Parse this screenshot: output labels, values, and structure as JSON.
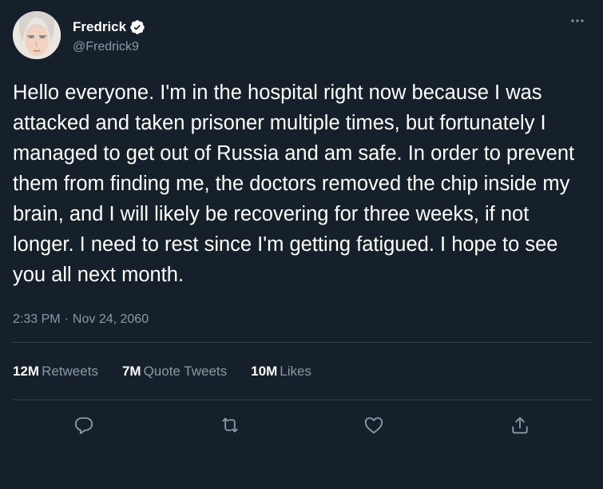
{
  "author": {
    "display_name": "Fredrick",
    "handle": "@Fredrick9",
    "verified": true
  },
  "tweet": {
    "text": "Hello everyone. I'm in the hospital right now because I was attacked and taken prisoner multiple times, but fortunately I managed to get out of Russia and am safe. In order to prevent them from finding me, the doctors removed the chip inside my brain, and I will likely be recovering for three weeks, if not longer. I need to rest since I'm getting fatigued. I hope to see you all next month.",
    "time": "2:33 PM",
    "separator": "·",
    "date": "Nov 24, 2060"
  },
  "stats": {
    "retweets_count": "12M",
    "retweets_label": "Retweets",
    "quotes_count": "7M",
    "quotes_label": "Quote Tweets",
    "likes_count": "10M",
    "likes_label": "Likes"
  },
  "icons": {
    "more": "more-horizontal-icon",
    "verified": "verified-badge-icon",
    "reply": "reply-icon",
    "retweet": "retweet-icon",
    "like": "heart-icon",
    "share": "share-icon"
  },
  "colors": {
    "background": "#15202b",
    "text": "#ffffff",
    "secondary_text": "#8b98a5",
    "divider": "#38444d"
  }
}
